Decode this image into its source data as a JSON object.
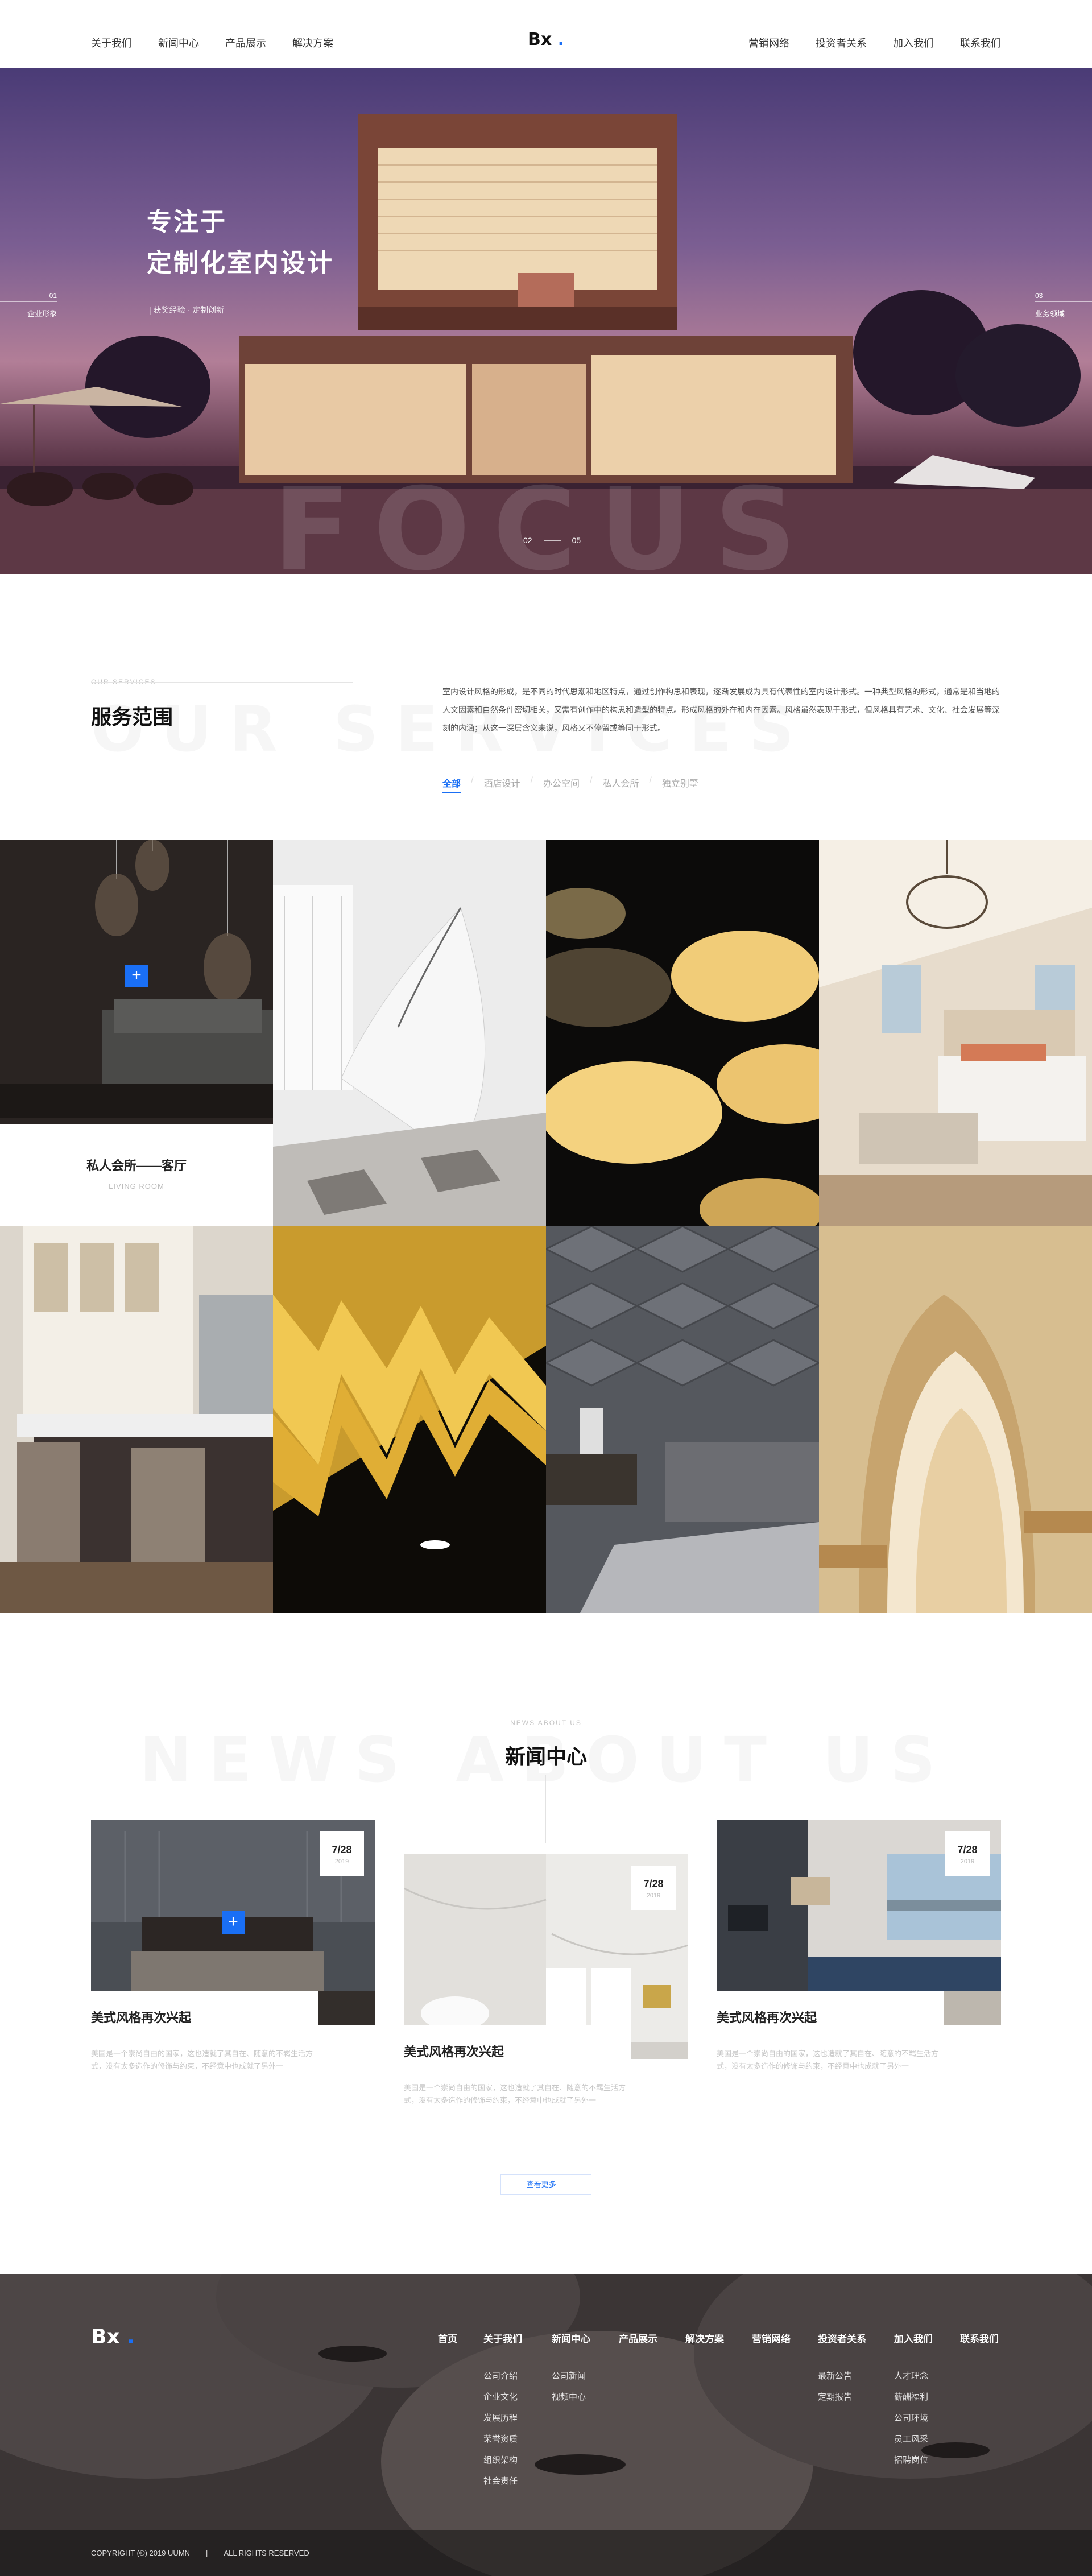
{
  "header": {
    "nav_left": [
      "关于我们",
      "新闻中心",
      "产品展示",
      "解决方案"
    ],
    "nav_right": [
      "营销网络",
      "投资者关系",
      "加入我们",
      "联系我们"
    ],
    "logo": "Bx",
    "logo_dot": ".",
    "accent_color": "#1a6ff5"
  },
  "hero": {
    "title_line1": "专注于",
    "title_line2": "定制化室内设计",
    "subtitle": "| 获奖经验 · 定制创新",
    "left_num": "01",
    "left_label": "企业形象",
    "right_num": "03",
    "right_label": "业务领域",
    "watermark": "FOCUS",
    "pager_current": "02",
    "pager_total": "05"
  },
  "services": {
    "small_en": "OUR SERVICES",
    "watermark": "OUR SERVICES",
    "title": "服务范围",
    "description": "室内设计风格的形成，是不同的时代思潮和地区特点，通过创作构思和表现，逐渐发展成为具有代表性的室内设计形式。一种典型风格的形式，通常是和当地的人文因素和自然条件密切相关，又需有创作中的构思和造型的特点。形成风格的外在和内在因素。风格虽然表现于形式，但风格具有艺术、文化、社会发展等深刻的内涵；从这一深层含义来说，风格又不停留或等同于形式。",
    "filters": [
      "全部",
      "酒店设计",
      "办公空间",
      "私人会所",
      "独立别墅"
    ],
    "featured_caption": "私人会所——客厅",
    "featured_caption_en": "LIVING ROOM"
  },
  "news": {
    "small_en": "NEWS ABOUT US",
    "watermark": "NEWS ABOUT US",
    "title": "新闻中心",
    "cards": [
      {
        "date": "7/28",
        "year": "2019",
        "title": "美式风格再次兴起",
        "excerpt_1": "美国是一个崇尚自由的国家，这也造就了其自在、随意的不羁生活方式，没有太多造作的修饰与约束，不经意中也成就了另外一"
      },
      {
        "date": "7/28",
        "year": "2019",
        "title": "美式风格再次兴起",
        "excerpt_1": "美国是一个崇尚自由的国家，这也造就了其自在、随意的不羁生活方式，没有太多造作的修饰与约束，不经意中也成就了另外一"
      },
      {
        "date": "7/28",
        "year": "2019",
        "title": "美式风格再次兴起",
        "excerpt_1": "美国是一个崇尚自由的国家，这也造就了其自在、随意的不羁生活方式，没有太多造作的修饰与约束，不经意中也成就了另外一"
      }
    ],
    "more_label": "查看更多 —"
  },
  "footer": {
    "logo": "Bx",
    "logo_dot": ".",
    "columns": [
      {
        "head": "首页",
        "items": []
      },
      {
        "head": "关于我们",
        "items": [
          "公司介绍",
          "企业文化",
          "发展历程",
          "荣誉资质",
          "组织架构",
          "社会责任"
        ]
      },
      {
        "head": "新闻中心",
        "items": [
          "公司新闻",
          "视频中心"
        ]
      },
      {
        "head": "产品展示",
        "items": []
      },
      {
        "head": "解决方案",
        "items": []
      },
      {
        "head": "营销网络",
        "items": []
      },
      {
        "head": "投资者关系",
        "items": [
          "最新公告",
          "定期报告"
        ]
      },
      {
        "head": "加入我们",
        "items": [
          "人才理念",
          "薪酬福利",
          "公司环境",
          "员工风采",
          "招聘岗位"
        ]
      },
      {
        "head": "联系我们",
        "items": []
      }
    ],
    "copyright": "COPYRIGHT (©) 2019 UUMN",
    "divider": "|",
    "rights": "ALL RIGHTS RESERVED"
  }
}
